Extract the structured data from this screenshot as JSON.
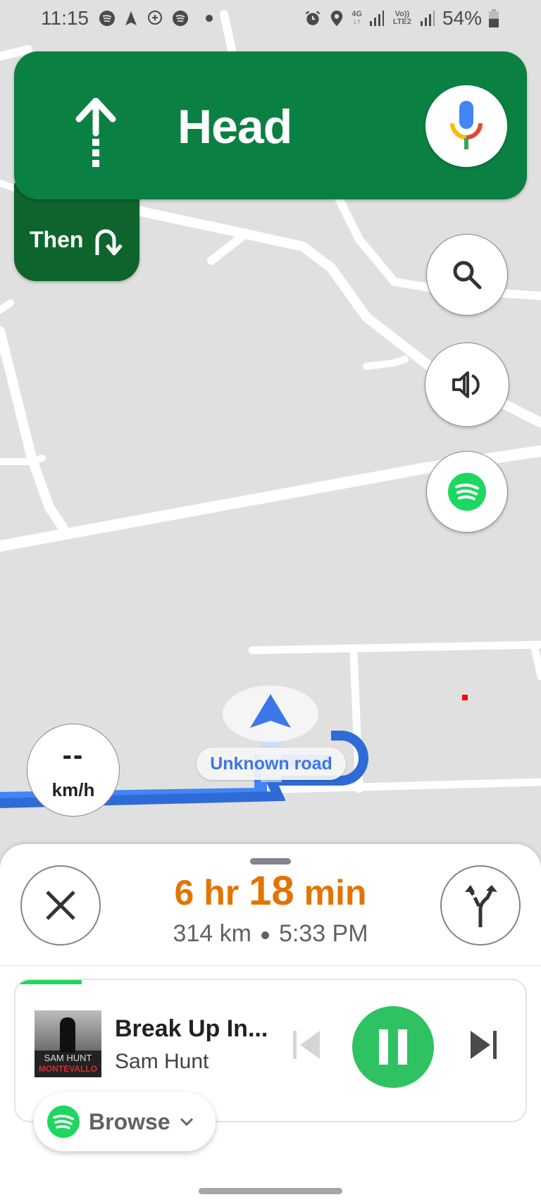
{
  "status_bar": {
    "time": "11:15",
    "left_icons": [
      "spotify-icon",
      "navigation-icon",
      "chat-add-icon",
      "spotify-icon",
      "dot-icon"
    ],
    "right_icons": [
      "alarm-icon",
      "location-icon",
      "network-4g-icon",
      "signal-icon",
      "volte-lte2-icon",
      "signal-icon",
      "battery-icon"
    ],
    "network_type": "4G",
    "volte_label": "Vo)) LTE2",
    "battery": "54%",
    "battery_level": 0.54
  },
  "navigation": {
    "maneuver_icon": "straight-arrow-icon",
    "instruction": "Head",
    "then_label": "Then",
    "then_icon": "u-turn-right-icon",
    "colors": {
      "primary": "#0b8043",
      "secondary": "#0d652d"
    }
  },
  "map": {
    "road_label": "Unknown road",
    "speed_value": "--",
    "speed_unit": "km/h",
    "buttons": [
      "search-icon",
      "volume-icon",
      "spotify-icon"
    ],
    "route_color": "#3b78e7"
  },
  "trip": {
    "hours": "6",
    "hours_unit": "hr",
    "minutes": "18",
    "minutes_unit": "min",
    "distance": "314 km",
    "arrival": "5:33 PM",
    "eta_color": "#e37400"
  },
  "media": {
    "title": "Break Up In...",
    "artist": "Sam Hunt",
    "album_art_artist": "SAM HUNT",
    "album_art_album": "MONTEVALLO",
    "progress": 0.13,
    "state": "playing",
    "browse_label": "Browse",
    "accent": "#1ed760"
  }
}
